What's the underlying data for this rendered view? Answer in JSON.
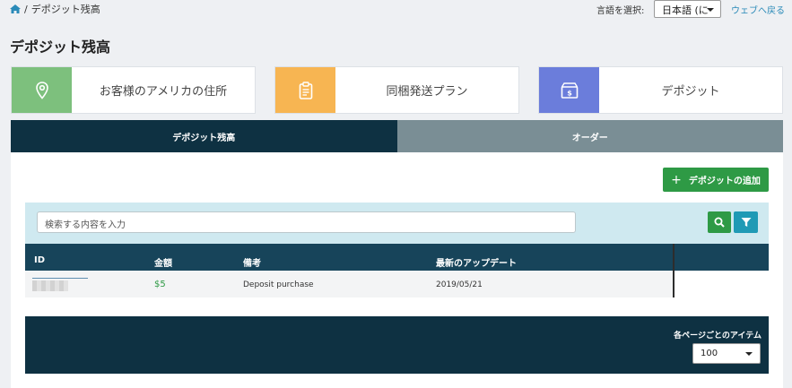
{
  "breadcrumb": {
    "separator": "/",
    "current": "デポジット残高"
  },
  "header": {
    "language_label": "言語を選択:",
    "language_value": "日本語 (に",
    "back_link": "ウェブへ戻る"
  },
  "page_title": "デポジット残高",
  "cards": [
    {
      "label": "お客様のアメリカの住所",
      "icon": "map-pin-icon",
      "color": "#7dc07d"
    },
    {
      "label": "同梱発送プラン",
      "icon": "clipboard-icon",
      "color": "#f7b552"
    },
    {
      "label": "デポジット",
      "icon": "money-box-icon",
      "color": "#6b7ddb"
    }
  ],
  "tabs": [
    {
      "label": "デポジット残高",
      "active": true
    },
    {
      "label": "オーダー",
      "active": false
    }
  ],
  "actions": {
    "add_deposit": "デポジットの追加"
  },
  "search": {
    "placeholder": "検索する内容を入力"
  },
  "table": {
    "columns": [
      "ID",
      "金額",
      "備考",
      "最新のアップデート"
    ],
    "rows": [
      {
        "id": "",
        "amount": "$5",
        "note": "Deposit purchase",
        "updated": "2019/05/21"
      }
    ]
  },
  "pagination": {
    "per_page_label": "各ページごとのアイテム",
    "per_page_value": "100"
  },
  "colors": {
    "primary_dark": "#0e3142",
    "success": "#2e9a45",
    "info": "#1f9ab5"
  }
}
